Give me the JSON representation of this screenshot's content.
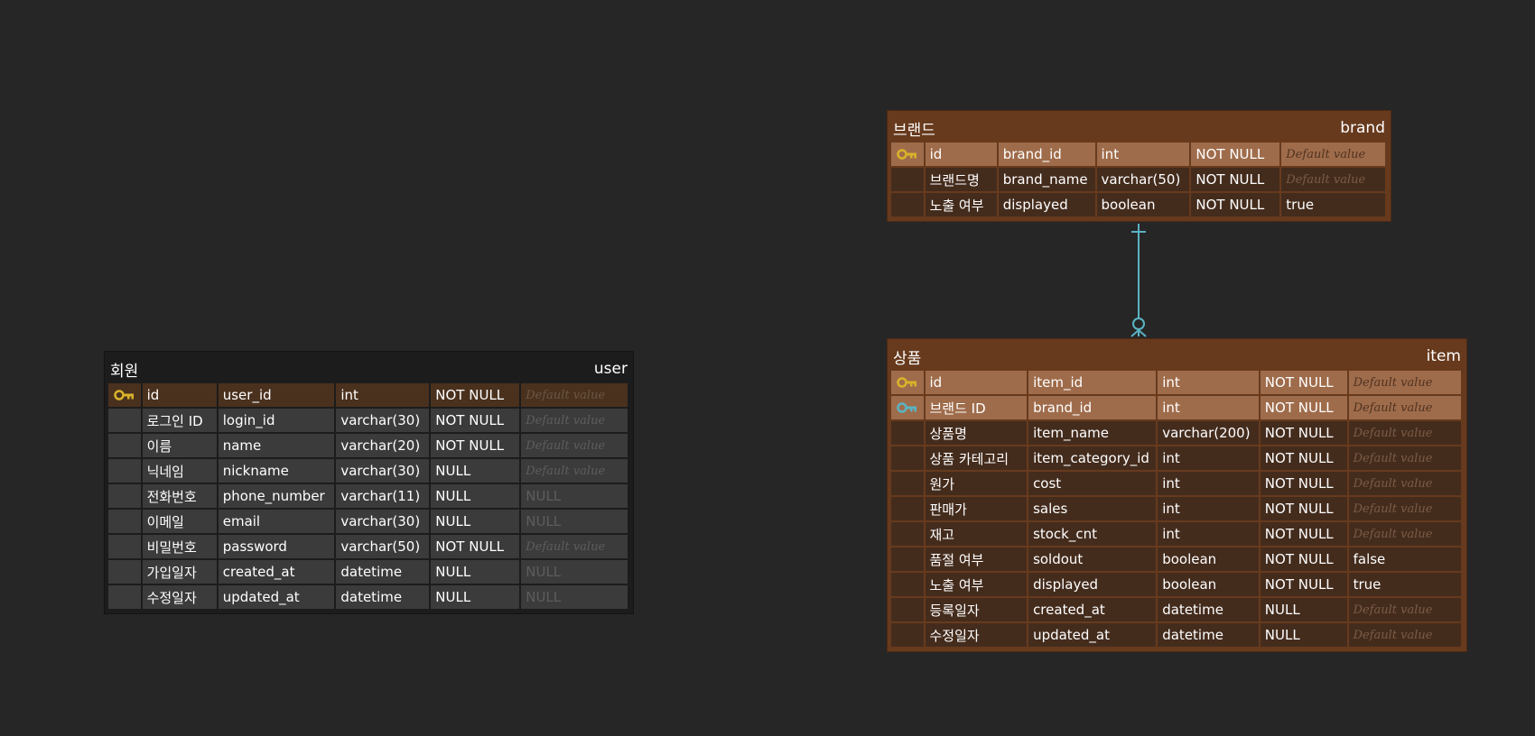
{
  "colors": {
    "canvas": "#262626",
    "relation_line": "#5ab3c3",
    "pk_key": "#d9b22b",
    "fk_key": "#5ab3c3"
  },
  "tables": {
    "user": {
      "title_ko": "회원",
      "title_en": "user",
      "rows": [
        {
          "key": "pk",
          "label": "id",
          "column": "user_id",
          "type": "int",
          "nullable": "NOT NULL",
          "default": "Default value",
          "default_literal": false
        },
        {
          "key": "",
          "label": "로그인 ID",
          "column": "login_id",
          "type": "varchar(30)",
          "nullable": "NOT NULL",
          "default": "Default value",
          "default_literal": false
        },
        {
          "key": "",
          "label": "이름",
          "column": "name",
          "type": "varchar(20)",
          "nullable": "NOT NULL",
          "default": "Default value",
          "default_literal": false
        },
        {
          "key": "",
          "label": "닉네임",
          "column": "nickname",
          "type": "varchar(30)",
          "nullable": "NULL",
          "default": "Default value",
          "default_literal": false
        },
        {
          "key": "",
          "label": "전화번호",
          "column": "phone_number",
          "type": "varchar(11)",
          "nullable": "NULL",
          "default": "NULL",
          "default_literal": true
        },
        {
          "key": "",
          "label": "이메일",
          "column": "email",
          "type": "varchar(30)",
          "nullable": "NULL",
          "default": "NULL",
          "default_literal": true
        },
        {
          "key": "",
          "label": "비밀번호",
          "column": "password",
          "type": "varchar(50)",
          "nullable": "NOT NULL",
          "default": "Default value",
          "default_literal": false
        },
        {
          "key": "",
          "label": "가입일자",
          "column": "created_at",
          "type": "datetime",
          "nullable": "NULL",
          "default": "NULL",
          "default_literal": true
        },
        {
          "key": "",
          "label": "수정일자",
          "column": "updated_at",
          "type": "datetime",
          "nullable": "NULL",
          "default": "NULL",
          "default_literal": true
        }
      ]
    },
    "brand": {
      "title_ko": "브랜드",
      "title_en": "brand",
      "rows": [
        {
          "key": "pk",
          "label": "id",
          "column": "brand_id",
          "type": "int",
          "nullable": "NOT NULL",
          "default": "Default value",
          "default_literal": false
        },
        {
          "key": "",
          "label": "브랜드명",
          "column": "brand_name",
          "type": "varchar(50)",
          "nullable": "NOT NULL",
          "default": "Default value",
          "default_literal": false
        },
        {
          "key": "",
          "label": "노출 여부",
          "column": "displayed",
          "type": "boolean",
          "nullable": "NOT NULL",
          "default": "true",
          "default_literal": true
        }
      ]
    },
    "item": {
      "title_ko": "상품",
      "title_en": "item",
      "rows": [
        {
          "key": "pk",
          "label": "id",
          "column": "item_id",
          "type": "int",
          "nullable": "NOT NULL",
          "default": "Default value",
          "default_literal": false
        },
        {
          "key": "fk",
          "label": "브랜드 ID",
          "column": "brand_id",
          "type": "int",
          "nullable": "NOT NULL",
          "default": "Default value",
          "default_literal": false
        },
        {
          "key": "",
          "label": "상품명",
          "column": "item_name",
          "type": "varchar(200)",
          "nullable": "NOT NULL",
          "default": "Default value",
          "default_literal": false
        },
        {
          "key": "",
          "label": "상품 카테고리",
          "column": "item_category_id",
          "type": "int",
          "nullable": "NOT NULL",
          "default": "Default value",
          "default_literal": false
        },
        {
          "key": "",
          "label": "원가",
          "column": "cost",
          "type": "int",
          "nullable": "NOT NULL",
          "default": "Default value",
          "default_literal": false
        },
        {
          "key": "",
          "label": "판매가",
          "column": "sales",
          "type": "int",
          "nullable": "NOT NULL",
          "default": "Default value",
          "default_literal": false
        },
        {
          "key": "",
          "label": "재고",
          "column": "stock_cnt",
          "type": "int",
          "nullable": "NOT NULL",
          "default": "Default value",
          "default_literal": false
        },
        {
          "key": "",
          "label": "품절 여부",
          "column": "soldout",
          "type": "boolean",
          "nullable": "NOT NULL",
          "default": "false",
          "default_literal": true
        },
        {
          "key": "",
          "label": "노출 여부",
          "column": "displayed",
          "type": "boolean",
          "nullable": "NOT NULL",
          "default": "true",
          "default_literal": true
        },
        {
          "key": "",
          "label": "등록일자",
          "column": "created_at",
          "type": "datetime",
          "nullable": "NULL",
          "default": "Default value",
          "default_literal": false
        },
        {
          "key": "",
          "label": "수정일자",
          "column": "updated_at",
          "type": "datetime",
          "nullable": "NULL",
          "default": "Default value",
          "default_literal": false
        }
      ]
    }
  },
  "relations": [
    {
      "from": "brand",
      "to": "item",
      "from_cardinality": "one",
      "to_cardinality": "zero-or-many"
    }
  ]
}
